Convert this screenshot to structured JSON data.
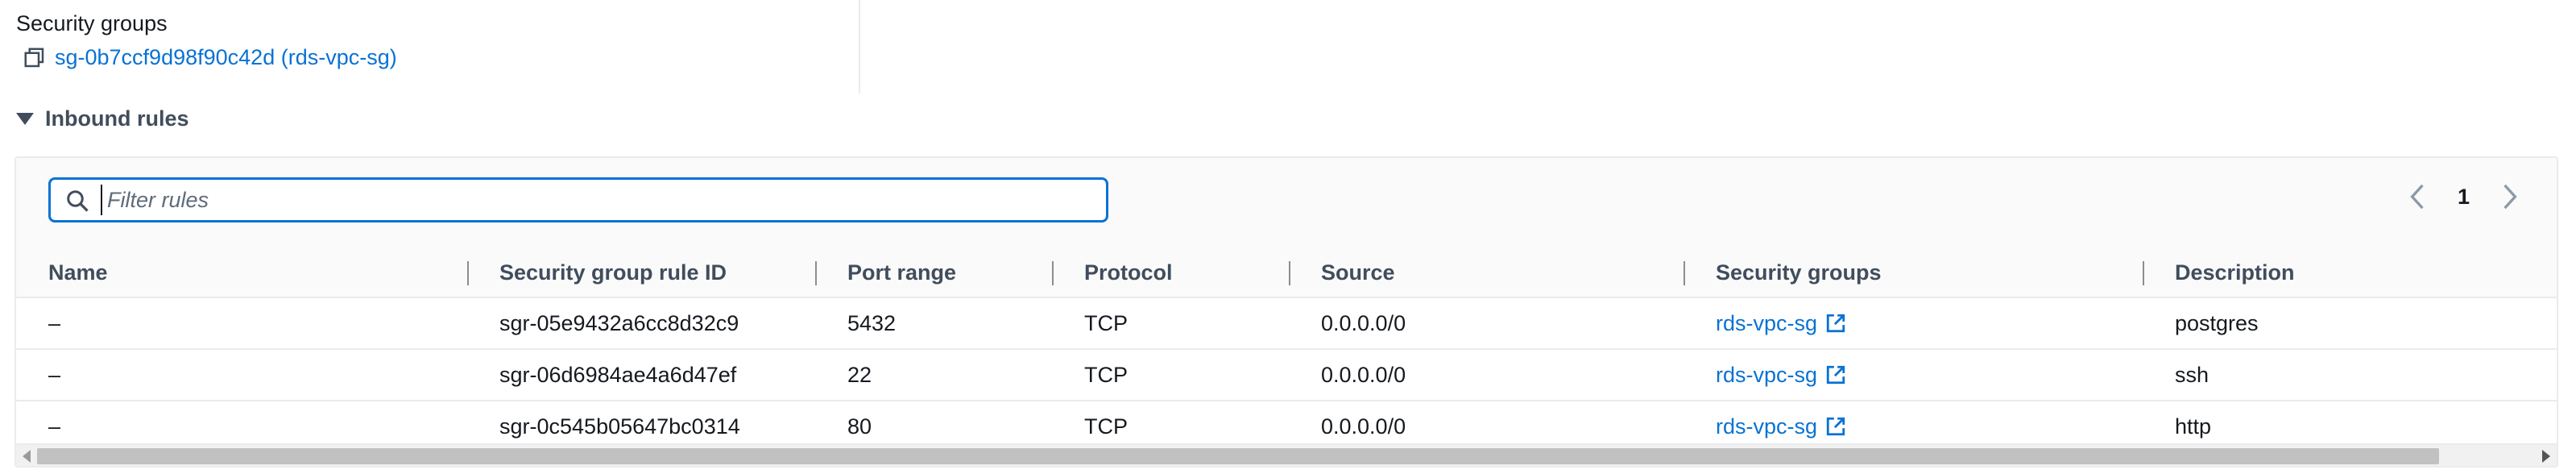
{
  "security_groups": {
    "label": "Security groups",
    "link": "sg-0b7ccf9d98f90c42d (rds-vpc-sg)"
  },
  "inbound": {
    "title": "Inbound rules",
    "filter_placeholder": "Filter rules",
    "page": "1",
    "columns": [
      "Name",
      "Security group rule ID",
      "Port range",
      "Protocol",
      "Source",
      "Security groups",
      "Description"
    ],
    "rows": [
      {
        "name": "–",
        "rule_id": "sgr-05e9432a6cc8d32c9",
        "port": "5432",
        "protocol": "TCP",
        "source": "0.0.0.0/0",
        "sg": "rds-vpc-sg",
        "description": "postgres"
      },
      {
        "name": "–",
        "rule_id": "sgr-06d6984ae4a6d47ef",
        "port": "22",
        "protocol": "TCP",
        "source": "0.0.0.0/0",
        "sg": "rds-vpc-sg",
        "description": "ssh"
      },
      {
        "name": "–",
        "rule_id": "sgr-0c545b05647bc0314",
        "port": "80",
        "protocol": "TCP",
        "source": "0.0.0.0/0",
        "sg": "rds-vpc-sg",
        "description": "http"
      }
    ]
  },
  "colors": {
    "link": "#0972d3",
    "text": "#16191f",
    "header_text": "#414d5c",
    "border": "#e9ebed"
  }
}
